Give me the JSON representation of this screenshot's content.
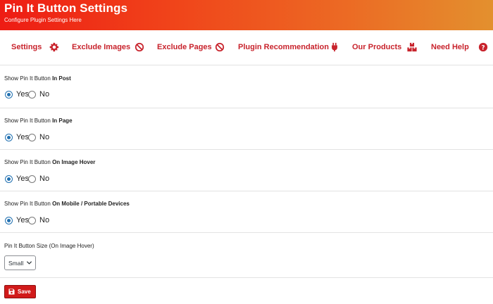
{
  "header": {
    "title": "Pin It Button Settings",
    "subtitle": "Configure Plugin Settings Here",
    "gradient": [
      "#ee1c14",
      "#e3902e"
    ]
  },
  "nav": {
    "accent_color": "#c8232c",
    "items": [
      {
        "label": "Settings",
        "icon": "gear-icon"
      },
      {
        "label": "Exclude Images",
        "icon": "ban-icon"
      },
      {
        "label": "Exclude Pages",
        "icon": "ban-icon"
      },
      {
        "label": "Plugin Recommendation",
        "icon": "plug-icon"
      },
      {
        "label": "Our Products",
        "icon": "boxes-icon"
      },
      {
        "label": "Need Help",
        "icon": "question-circle-icon"
      }
    ]
  },
  "settings": [
    {
      "prefix": "Show Pin It Button",
      "emphasis": "In Post",
      "yes_label": "Yes",
      "no_label": "No",
      "selected": "Yes"
    },
    {
      "prefix": "Show Pin It Button",
      "emphasis": "In Page",
      "yes_label": "Yes",
      "no_label": "No",
      "selected": "Yes"
    },
    {
      "prefix": "Show Pin It Button",
      "emphasis": "On Image Hover",
      "yes_label": "Yes",
      "no_label": "No",
      "selected": "Yes"
    },
    {
      "prefix": "Show Pin It Button",
      "emphasis": "On Mobile / Portable Devices",
      "yes_label": "Yes",
      "no_label": "No",
      "selected": "Yes"
    }
  ],
  "size": {
    "label": "Pin It Button Size (On Image Hover)",
    "selected": "Small"
  },
  "save": {
    "label": "Save",
    "color": "#d11a1a",
    "icon": "save-icon"
  }
}
